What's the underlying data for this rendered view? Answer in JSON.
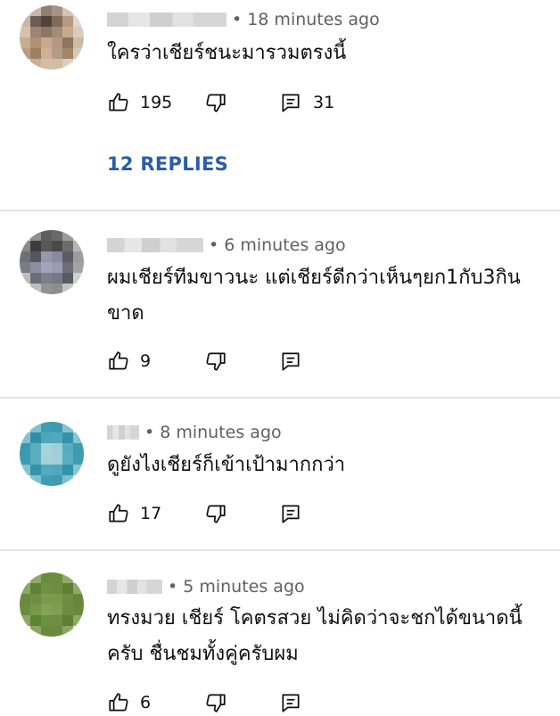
{
  "comments": [
    {
      "time": "18 minutes ago",
      "text": "ใครว่าเชียร์ชนะมารวมตรงนี้",
      "likes": "195",
      "replies": "31",
      "replies_link": "12 REPLIES",
      "avatar_colors": [
        "#d9d4cf",
        "#c9b9a8",
        "#8e7f70",
        "#a59383",
        "#d1c4b5",
        "#e6ded6",
        "#c7b6a4",
        "#6b5d52",
        "#4d443e",
        "#7e6b5c",
        "#b39a84",
        "#e0d7cd",
        "#d6c2ab",
        "#9c8572",
        "#8d7766",
        "#a28b78",
        "#c9a98a",
        "#d9cbbd",
        "#c8ad92",
        "#b18f70",
        "#caa98b",
        "#b09a86",
        "#8e7560",
        "#cdbba8",
        "#b99d82",
        "#a07e62",
        "#d0b193",
        "#b49c86",
        "#a1846a",
        "#d5c7b8",
        "#e3d8cc",
        "#c6b19b",
        "#d3bda6",
        "#cfbca9",
        "#dccfc1",
        "#efe9e3"
      ]
    },
    {
      "time": "6 minutes ago",
      "text": "ผมเชียร์ทีมขาวนะ แต่เชียร์ดีกว่าเห็นๆยก1กับ3กินขาด",
      "likes": "9",
      "replies": "",
      "avatar_colors": [
        "#c9c9c9",
        "#8f8f8f",
        "#5e5e5e",
        "#6a6a6a",
        "#9a9a9a",
        "#d8d8d8",
        "#8a8a8a",
        "#3e3e3e",
        "#585858",
        "#4a4a4a",
        "#6c6c6c",
        "#b5b5b5",
        "#6f6f78",
        "#55555e",
        "#9a97a8",
        "#8b88a0",
        "#5c5c66",
        "#9c9c9c",
        "#7b7b85",
        "#8f8ca3",
        "#a5a2bc",
        "#9c99b2",
        "#6e6c7a",
        "#a3a3a3",
        "#bdbdbd",
        "#6d6d75",
        "#7f7e8c",
        "#787785",
        "#5a5a62",
        "#cfcfcf",
        "#e6e6e6",
        "#bfbfbf",
        "#939393",
        "#8d8d8d",
        "#c3c3c3",
        "#ededed"
      ]
    },
    {
      "time": "8 minutes ago",
      "text": "ดูยังไงเชียร์ก็เข้าเป้ามากกว่า",
      "likes": "17",
      "replies": "",
      "avatar_colors": [
        "#d8ebef",
        "#7fc0cd",
        "#3f9eb2",
        "#3c9bb0",
        "#83c3cf",
        "#dbedf1",
        "#82c2ce",
        "#2f8fa6",
        "#4ea6b8",
        "#52a9ba",
        "#3393a9",
        "#85c4d0",
        "#3a99ae",
        "#5aaebf",
        "#a6d3dc",
        "#9fcfd9",
        "#58acbd",
        "#3d9bb0",
        "#3b9aaf",
        "#5badbe",
        "#a3d2db",
        "#a1d0da",
        "#59adbe",
        "#3e9cb1",
        "#84c3cf",
        "#3494aa",
        "#53aabb",
        "#50a8ba",
        "#3293a9",
        "#86c4d0",
        "#dcedf1",
        "#81c1cd",
        "#3f9eb2",
        "#3d9cb1",
        "#80c0cc",
        "#dfeff2"
      ]
    },
    {
      "time": "5 minutes ago",
      "text": "ทรงมวย เชียร์ โคตรสวย ไม่คิดว่าจะชกได้ขนาดนี้ ครับ ชื่นชมทั้งคู่ครับผม",
      "likes": "6",
      "replies": "",
      "avatar_colors": [
        "#d9e2cc",
        "#8ea866",
        "#6a8c40",
        "#6b8d41",
        "#90aa68",
        "#dbe4ce",
        "#8da765",
        "#5f8236",
        "#6f9045",
        "#6c8e42",
        "#5d8034",
        "#8fa967",
        "#69893d",
        "#6f9044",
        "#7a9a4e",
        "#789a4c",
        "#6d8e43",
        "#66883b",
        "#6b8c40",
        "#779849",
        "#84a356",
        "#7f9f52",
        "#6c8d42",
        "#68893e",
        "#8ea765",
        "#5e8135",
        "#6e8f44",
        "#6d8e43",
        "#5c7f33",
        "#8fa866",
        "#dde5d0",
        "#8ca664",
        "#6a8b3f",
        "#6a8c40",
        "#8ba563",
        "#e0e7d3"
      ]
    }
  ]
}
